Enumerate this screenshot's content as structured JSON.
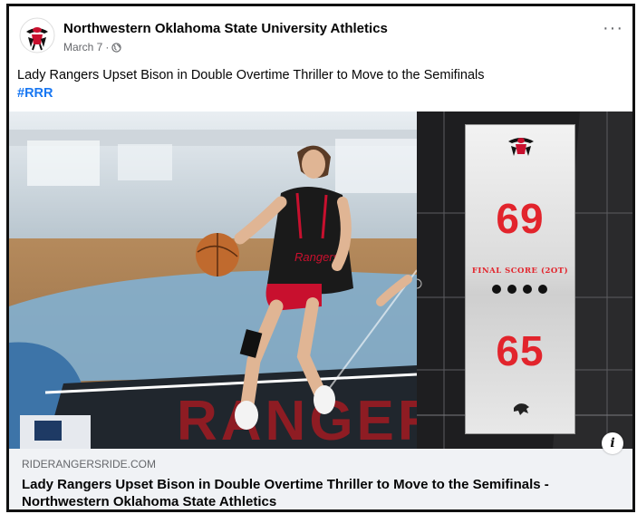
{
  "post": {
    "page_name": "Northwestern Oklahoma State University Athletics",
    "date": "March 7",
    "meta_separator": "·",
    "privacy_icon": "globe-icon",
    "more_icon": "more-options-icon",
    "more_label": "···",
    "text": "Lady Rangers Upset Bison in Double Overtime Thriller to Move to the Semifinals",
    "hashtag": "#RRR"
  },
  "media": {
    "score_top": "69",
    "final_label": "FINAL SCORE (2OT)",
    "score_bottom": "65",
    "overtime_dots": 4,
    "court_text": "RANGER",
    "jersey_text": "Rangers",
    "info_icon": "info-icon",
    "info_label": "i",
    "colors": {
      "score_red": "#e2242c",
      "ranger_red": "#c8102e",
      "jersey_black": "#1a1a1a"
    }
  },
  "link": {
    "domain": "RIDERANGERSRIDE.COM",
    "title": "Lady Rangers Upset Bison in Double Overtime Thriller to Move to the Semifinals - Northwestern Oklahoma State Athletics"
  }
}
